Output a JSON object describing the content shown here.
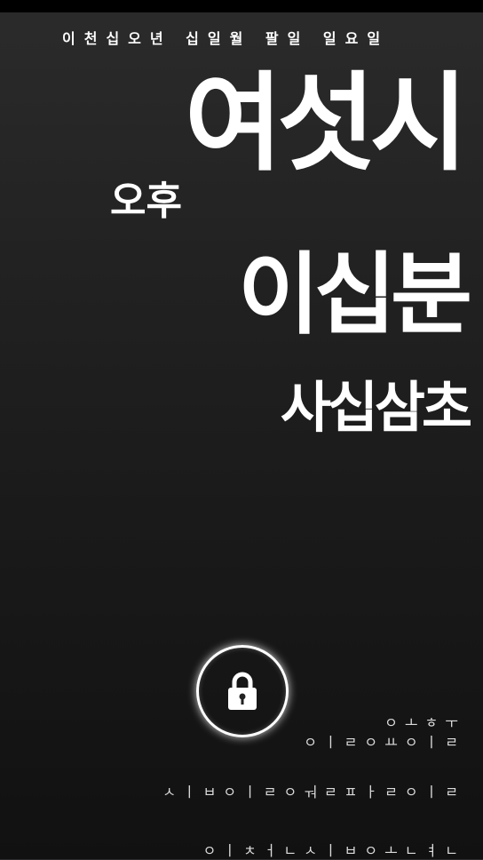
{
  "date": "이천십오년 십일월 팔일 일요일",
  "clock": {
    "ampm": "오후",
    "hour": "여섯시",
    "minute": "이십분",
    "second": "사십삼초"
  },
  "lock": {
    "icon": "padlock-icon"
  },
  "info": {
    "line1": "ㅇㅗㅎㅜ",
    "line2": "ㅇㅣㄹㅇㅛㅇㅣㄹ",
    "line3": "ㅅㅣㅂㅇㅣㄹㅇㅝㄹㅍㅏㄹㅇㅣㄹ",
    "line4": "ㅇㅣㅊㅓㄴㅅㅣㅂㅇㅗㄴㅕㄴ"
  }
}
